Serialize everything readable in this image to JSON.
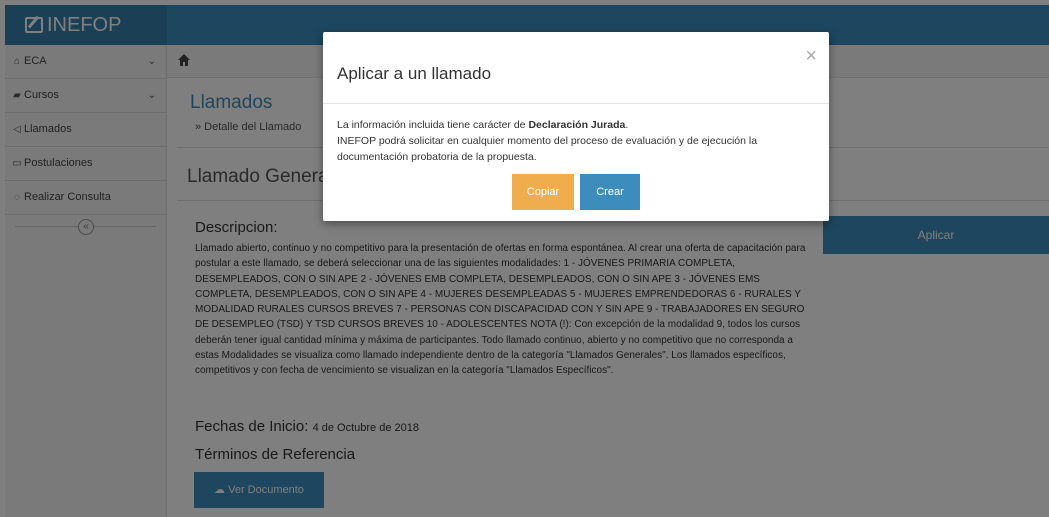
{
  "header": {
    "brand": "INEFOP"
  },
  "sidebar": {
    "items": [
      {
        "label": "ECA",
        "has_chevron": true
      },
      {
        "label": "Cursos",
        "has_chevron": true
      },
      {
        "label": "Llamados",
        "has_chevron": false
      },
      {
        "label": "Postulaciones",
        "has_chevron": false
      },
      {
        "label": "Realizar Consulta",
        "has_chevron": false
      }
    ]
  },
  "page": {
    "title": "Llamados",
    "breadcrumb": "» Detalle del Llamado",
    "box_title": "Llamado Generales",
    "apply_button": "Aplicar",
    "description_heading": "Descripcion:",
    "description": "Llamado abierto, continuo y no competitivo para la presentación de ofertas en forma espontánea. Al crear una oferta de capacitación para postular a este llamado, se deberá seleccionar una de las siguientes modalidades: 1 - JÓVENES PRIMARIA COMPLETA, DESEMPLEADOS, CON O SIN APE 2 - JÓVENES EMB COMPLETA, DESEMPLEADOS, CON O SIN APE 3 - JÓVENES EMS COMPLETA, DESEMPLEADOS, CON O SIN APE 4 - MUJERES DESEMPLEADAS 5 - MUJERES EMPRENDEDORAS 6 - RURALES Y MODALIDAD RURALES CURSOS BREVES 7 - PERSONAS CON DISCAPACIDAD CON Y SIN APE 9 - TRABAJADORES EN SEGURO DE DESEMPLEO (TSD) Y TSD CURSOS BREVES 10 - ADOLESCENTES NOTA (!): Con excepción de la modalidad 9, todos los cursos deberán tener igual cantidad mínima y máxima de participantes. Todo llamado continuo, abierto y no competitivo que no corresponda a estas Modalidades se visualiza como llamado independiente dentro de la categoría \"Llamados Generales\". Los llamados específicos, competitivos y con fecha de vencimiento se visualizan en la categoría \"Llamados Específicos\".",
    "dates_label": "Fechas de Inicio:",
    "dates_value": "4 de Octubre de 2018",
    "terms_heading": "Términos de Referencia",
    "view_document_button": "Ver Documento"
  },
  "modal": {
    "title": "Aplicar a un llamado",
    "close": "×",
    "body_prefix": "La información incluida tiene carácter de ",
    "body_bold": "Declaración Jurada",
    "body_suffix": ".",
    "body_line2": "INEFOP podrá solicitar en cualquier momento del proceso de evaluación y de ejecución la documentación probatoria de la propuesta.",
    "copy_button": "Copiar",
    "create_button": "Crear"
  },
  "colors": {
    "primary": "#3c8dbc",
    "warning": "#f0ad4e",
    "overlay": "rgba(0,0,0,0.5)"
  }
}
